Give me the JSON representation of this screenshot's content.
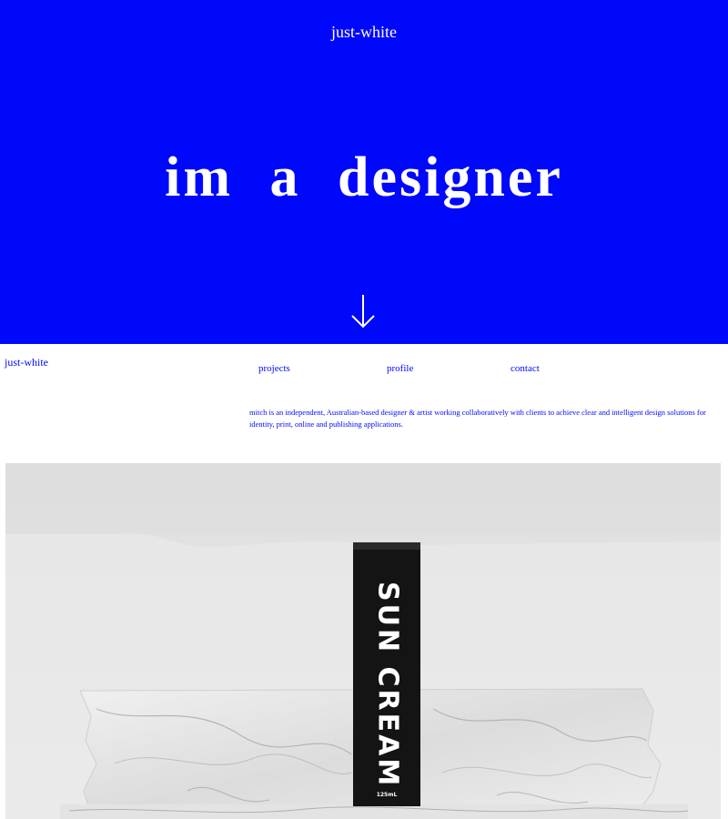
{
  "hero": {
    "logo": "just-white",
    "headline": "im a designer",
    "background_color": "#0008fc",
    "scroll_icon": "arrow-down-icon"
  },
  "nav": {
    "logo": "just-white",
    "links": [
      "projects",
      "profile",
      "contact"
    ]
  },
  "bio": {
    "text": "mitch is an independent, Australian-based designer & artist working collaboratively with clients to achieve clear and intelligent design solutions for identity, print, online and publishing applications."
  },
  "photo": {
    "product_label": "SUN CREAM",
    "product_volume": "125mL"
  }
}
